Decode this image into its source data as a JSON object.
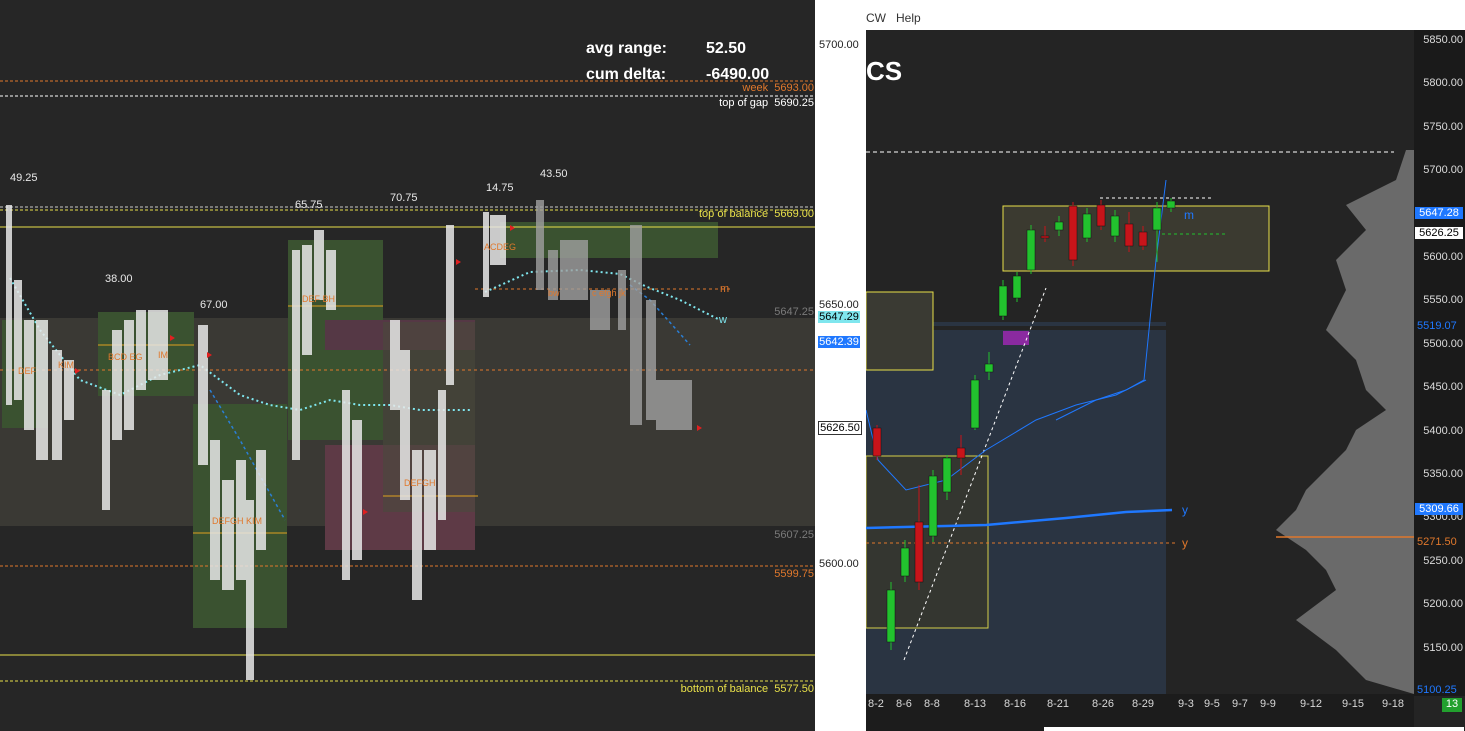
{
  "stats": {
    "avg_range_label": "avg range:",
    "avg_range_value": "52.50",
    "cum_delta_label": "cum delta:",
    "cum_delta_value": "-6490.00"
  },
  "levels": {
    "week_label": "week",
    "week_value": "5693.00",
    "gap_label": "top of gap",
    "gap_value": "5690.25",
    "tob_label": "top of balance",
    "tob_value": "5669.00",
    "bob_label": "bottom of balance",
    "bob_value": "5577.50",
    "lvl_5647": "5647.25",
    "lvl_5607": "5607.25",
    "lvl_5599": "5599.75",
    "marker_m": "m",
    "marker_w": "w"
  },
  "ranges": {
    "r1": "49.25",
    "r2": "38.00",
    "r3": "67.00",
    "r4": "65.75",
    "r5": "70.75",
    "r6": "14.75",
    "r7": "43.50"
  },
  "left_axis": {
    "p5700": "5700.00",
    "p5650": "5650.00",
    "p5600": "5600.00",
    "badge_cyan": "5647.29",
    "badge_blue": "5642.39",
    "badge_white": "5626.50"
  },
  "menu": {
    "cw": "CW",
    "help": "Help"
  },
  "right_title": "CS",
  "right_axis": {
    "ticks": [
      "5850.00",
      "5800.00",
      "5750.00",
      "5700.00",
      "5650.00",
      "5600.00",
      "5550.00",
      "5500.00",
      "5450.00",
      "5400.00",
      "5350.00",
      "5300.00",
      "5250.00",
      "5200.00",
      "5150.00"
    ],
    "badge_cur": "5647.28",
    "badge_last": "5626.25",
    "lvl_5519": "5519.07",
    "badge_5309": "5309.66",
    "lvl_5271": "5271.50",
    "low": "5100.25",
    "countdown": "13"
  },
  "right_markers": {
    "m": "m",
    "y_blue": "y",
    "y_orange": "y"
  },
  "dates": [
    "8-2",
    "8-6",
    "8-8",
    "8-13",
    "8-16",
    "8-21",
    "8-26",
    "8-29",
    "9-3",
    "9-5",
    "9-7",
    "9-9",
    "9-12",
    "9-15",
    "9-18"
  ],
  "colors": {
    "yellow": "#e8e04a",
    "orange": "#e0782c",
    "cyan": "#7fe6ee",
    "blue": "#1f78ff",
    "green_box": "#3c5a2a",
    "pink_box": "#6a3b4a",
    "candle_up": "#22c22e",
    "candle_down": "#c8141a"
  }
}
